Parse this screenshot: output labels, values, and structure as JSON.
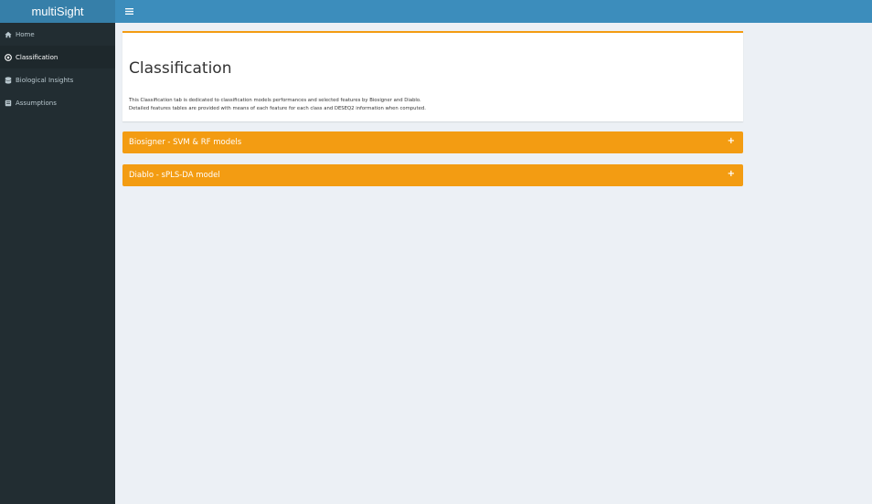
{
  "app": {
    "title": "multiSight",
    "toggle_icon": "hamburger-icon"
  },
  "sidebar": {
    "items": [
      {
        "label": "Home",
        "icon": "home-icon"
      },
      {
        "label": "Classification",
        "icon": "target-icon"
      },
      {
        "label": "Biological Insights",
        "icon": "database-icon"
      },
      {
        "label": "Assumptions",
        "icon": "book-icon"
      }
    ],
    "active_index": 1
  },
  "main": {
    "title": "Classification",
    "description_1": "This Classification tab is dedicated to classification models performances and selected features by Biosigner and Diablo.",
    "description_2": "Detailed features tables are provided with means of each feature for each class and DESEQ2 information when computed.",
    "panels": [
      {
        "label": "Biosigner - SVM & RF models",
        "icon": "+"
      },
      {
        "label": "Diablo - sPLS-DA model",
        "icon": "+"
      }
    ]
  },
  "colors": {
    "header": "#3c8dbc",
    "logo_bg": "#367fa9",
    "sidebar_bg": "#222d32",
    "accent": "#f39c12",
    "content_bg": "#ecf0f5"
  }
}
